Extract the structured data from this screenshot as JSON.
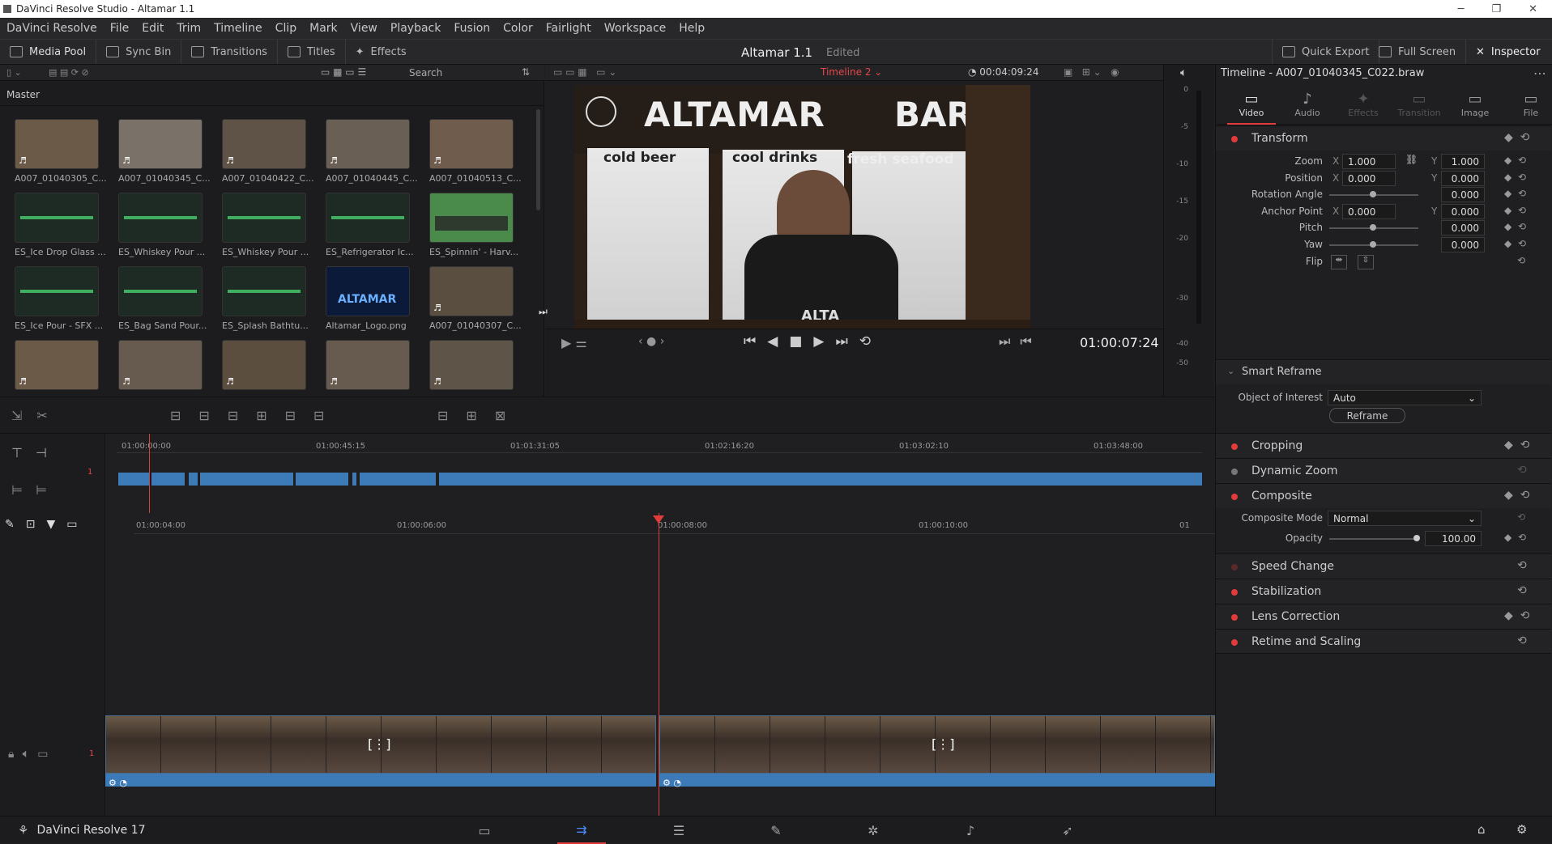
{
  "app": {
    "window_title": "DaVinci Resolve Studio - Altamar 1.1"
  },
  "menu": [
    "DaVinci Resolve",
    "File",
    "Edit",
    "Trim",
    "Timeline",
    "Clip",
    "Mark",
    "View",
    "Playback",
    "Fusion",
    "Color",
    "Fairlight",
    "Workspace",
    "Help"
  ],
  "toolbar": {
    "media_pool": "Media Pool",
    "sync_bin": "Sync Bin",
    "transitions": "Transitions",
    "titles": "Titles",
    "effects": "Effects",
    "project_title": "Altamar 1.1",
    "status": "Edited",
    "quick_export": "Quick Export",
    "full_screen": "Full Screen",
    "inspector": "Inspector"
  },
  "pool": {
    "search_placeholder": "Search",
    "bin": "Master",
    "clips": [
      {
        "name": "A007_01040305_C...",
        "kind": "video",
        "color": "#6b5a48"
      },
      {
        "name": "A007_01040345_C...",
        "kind": "video",
        "color": "#7a7268"
      },
      {
        "name": "A007_01040422_C...",
        "kind": "video",
        "color": "#5e5346"
      },
      {
        "name": "A007_01040445_C...",
        "kind": "video",
        "color": "#6a5f54"
      },
      {
        "name": "A007_01040513_C...",
        "kind": "video",
        "color": "#705c4c"
      },
      {
        "name": "ES_Ice Drop Glass ...",
        "kind": "audio",
        "color": "#1e2a24"
      },
      {
        "name": "ES_Whiskey Pour ...",
        "kind": "audio",
        "color": "#1e2a24"
      },
      {
        "name": "ES_Whiskey Pour ...",
        "kind": "audio",
        "color": "#1e2a24"
      },
      {
        "name": "ES_Refrigerator Ic...",
        "kind": "audio",
        "color": "#1e2a24"
      },
      {
        "name": "ES_Spinnin' - Harv...",
        "kind": "audio2",
        "color": "#4a8a4a"
      },
      {
        "name": "ES_Ice Pour - SFX ...",
        "kind": "audio",
        "color": "#1e2a24"
      },
      {
        "name": "ES_Bag Sand Pour...",
        "kind": "audio",
        "color": "#1e2a24"
      },
      {
        "name": "ES_Splash Bathtu...",
        "kind": "audio",
        "color": "#1e2a24"
      },
      {
        "name": "Altamar_Logo.png",
        "kind": "logo",
        "color": "#0c1a3a"
      },
      {
        "name": "A007_01040307_C...",
        "kind": "video",
        "color": "#5a4e40"
      },
      {
        "name": "",
        "kind": "video",
        "color": "#6b5a48"
      },
      {
        "name": "",
        "kind": "video",
        "color": "#665b4e"
      },
      {
        "name": "",
        "kind": "video",
        "color": "#5c4e3e"
      },
      {
        "name": "",
        "kind": "video",
        "color": "#675a4e"
      },
      {
        "name": "",
        "kind": "video",
        "color": "#5f5448"
      }
    ],
    "logo_text": "ALTAMAR"
  },
  "viewer": {
    "timeline_name": "Timeline 2",
    "duration": "00:04:09:24",
    "timecode": "01:00:07:24",
    "scene": {
      "header": "ALTAMAR",
      "header2": "BAR",
      "sign1": "cold beer",
      "sign2": "cool drinks",
      "sign3": "fresh seafood",
      "shirt": "ALTA"
    }
  },
  "meter_ticks": [
    "0",
    "-5",
    "-10",
    "-15",
    "-20",
    "-30",
    "-40",
    "-50"
  ],
  "upper_ruler": [
    "01:00:00:00",
    "01:00:45:15",
    "01:01:31:05",
    "01:02:16:20",
    "01:03:02:10",
    "01:03:48:00"
  ],
  "lower_ruler": [
    "01:00:04:00",
    "01:00:06:00",
    "01:00:08:00",
    "01:00:10:00",
    "01"
  ],
  "track_number": "1",
  "inspector": {
    "title": "Timeline - A007_01040345_C022.braw",
    "tabs": [
      "Video",
      "Audio",
      "Effects",
      "Transition",
      "Image",
      "File"
    ],
    "transform": {
      "label": "Transform",
      "zoom": "Zoom",
      "zoom_x": "1.000",
      "zoom_y": "1.000",
      "position": "Position",
      "pos_x": "0.000",
      "pos_y": "0.000",
      "rotation": "Rotation Angle",
      "rotation_val": "0.000",
      "anchor": "Anchor Point",
      "anchor_x": "0.000",
      "anchor_y": "0.000",
      "pitch": "Pitch",
      "pitch_val": "0.000",
      "yaw": "Yaw",
      "yaw_val": "0.000",
      "flip": "Flip",
      "x": "X",
      "y": "Y"
    },
    "smart_reframe": {
      "label": "Smart Reframe",
      "ooi_label": "Object of Interest",
      "ooi_value": "Auto",
      "button": "Reframe"
    },
    "cropping": "Cropping",
    "dynamic_zoom": "Dynamic Zoom",
    "composite": {
      "label": "Composite",
      "mode_label": "Composite Mode",
      "mode_value": "Normal",
      "opacity_label": "Opacity",
      "opacity_value": "100.00"
    },
    "speed_change": "Speed Change",
    "stabilization": "Stabilization",
    "lens_correction": "Lens Correction",
    "retime": "Retime and Scaling"
  },
  "footer": {
    "app_label": "DaVinci Resolve 17"
  },
  "colors": {
    "accent_red": "#e23b3b",
    "clip_blue": "#3d7ab8"
  }
}
